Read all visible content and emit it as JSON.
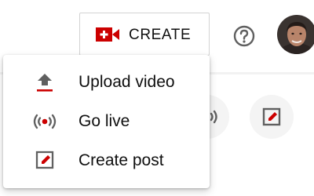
{
  "header": {
    "create_button": {
      "label": "CREATE",
      "icon": "video-camera-plus-icon"
    },
    "help_icon": "help-circle-icon",
    "avatar_icon": "user-avatar-icon"
  },
  "create_menu": {
    "items": [
      {
        "label": "Upload video",
        "icon": "upload-icon"
      },
      {
        "label": "Go live",
        "icon": "live-broadcast-icon"
      },
      {
        "label": "Create post",
        "icon": "edit-post-icon"
      }
    ]
  },
  "colors": {
    "brand_red": "#cc0000",
    "text_primary": "#0f0f0f",
    "icon_gray": "#606060"
  }
}
